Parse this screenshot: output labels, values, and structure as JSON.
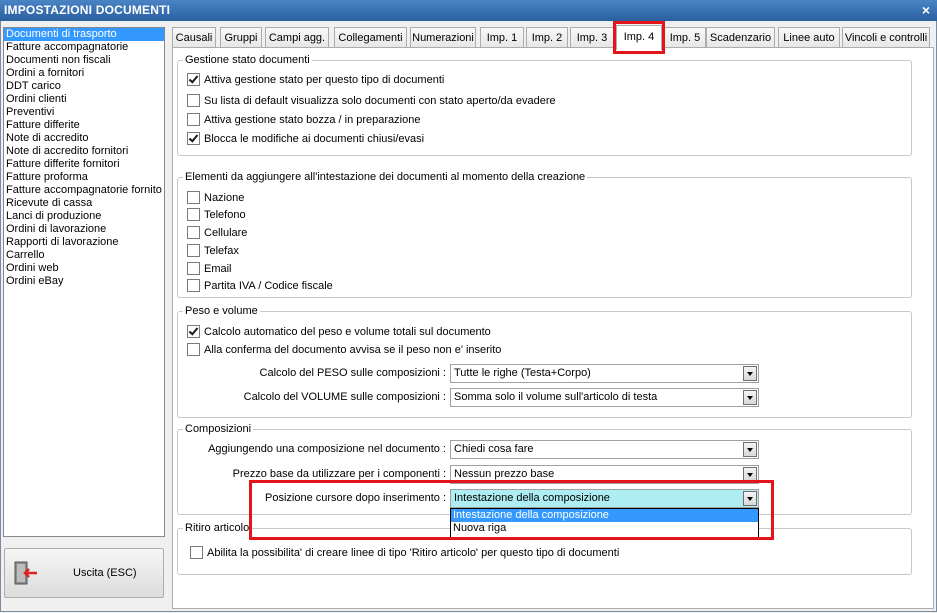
{
  "window": {
    "title": "IMPOSTAZIONI DOCUMENTI",
    "close": "×"
  },
  "doc_types": [
    "Documenti di trasporto",
    "Fatture accompagnatorie",
    "Documenti non fiscali",
    "Ordini a fornitori",
    "DDT carico",
    "Ordini clienti",
    "Preventivi",
    "Fatture differite",
    "Note di accredito",
    "Note di accredito fornitori",
    "Fatture differite fornitori",
    "Fatture proforma",
    "Fatture accompagnatorie fornito",
    "Ricevute di cassa",
    "Lanci di produzione",
    "Ordini di lavorazione",
    "Rapporti di lavorazione",
    "Carrello",
    "Ordini web",
    "Ordini eBay"
  ],
  "exit_button": {
    "label": "Uscita (ESC)"
  },
  "tabs": [
    "Causali",
    "Gruppi",
    "Campi agg.",
    "Collegamenti",
    "Numerazioni",
    "Imp. 1",
    "Imp. 2",
    "Imp. 3",
    "Imp. 4",
    "Imp. 5",
    "Scadenzario",
    "Linee auto",
    "Vincoli e controlli"
  ],
  "gestione_stato": {
    "legend": "Gestione stato documenti",
    "options": [
      {
        "label": "Attiva gestione stato per questo tipo di documenti",
        "checked": true
      },
      {
        "label": "Su lista di default visualizza solo documenti con stato aperto/da evadere",
        "checked": false
      },
      {
        "label": "Attiva gestione stato bozza / in preparazione",
        "checked": false
      },
      {
        "label": "Blocca le modifiche ai documenti chiusi/evasi",
        "checked": true
      }
    ]
  },
  "intestazione": {
    "legend": "Elementi da aggiungere all'intestazione dei documenti al momento della creazione",
    "options": [
      {
        "label": "Nazione",
        "checked": false
      },
      {
        "label": "Telefono",
        "checked": false
      },
      {
        "label": "Cellulare",
        "checked": false
      },
      {
        "label": "Telefax",
        "checked": false
      },
      {
        "label": "Email",
        "checked": false
      },
      {
        "label": "Partita IVA / Codice fiscale",
        "checked": false
      }
    ]
  },
  "peso": {
    "legend": "Peso e volume",
    "options": [
      {
        "label": "Calcolo automatico del peso e volume totali sul documento",
        "checked": true
      },
      {
        "label": "Alla conferma del documento avvisa se il peso non e' inserito",
        "checked": false
      }
    ],
    "peso_label": "Calcolo del PESO sulle composizioni :",
    "peso_value": "Tutte le righe (Testa+Corpo)",
    "volume_label": "Calcolo del VOLUME sulle composizioni :",
    "volume_value": "Somma solo il volume sull'articolo di testa"
  },
  "composizioni": {
    "legend": "Composizioni",
    "aggiungendo_label": "Aggiungendo una composizione nel documento :",
    "aggiungendo_value": "Chiedi cosa fare",
    "prezzo_label": "Prezzo base da utilizzare per i componenti :",
    "prezzo_value": "Nessun prezzo base",
    "cursore_label": "Posizione cursore dopo inserimento :",
    "cursore_value": "Intestazione della composizione",
    "cursore_options": [
      "Intestazione della composizione",
      "Nuova riga"
    ]
  },
  "ritiro": {
    "legend": "Ritiro articolo",
    "option": {
      "label": "Abilita la possibilita' di creare linee di tipo 'Ritiro articolo' per questo tipo di documenti",
      "checked": false
    }
  },
  "colors": {
    "highlight": "#e3151a",
    "selection": "#3399ff",
    "active_combo": "#aeeef2"
  }
}
